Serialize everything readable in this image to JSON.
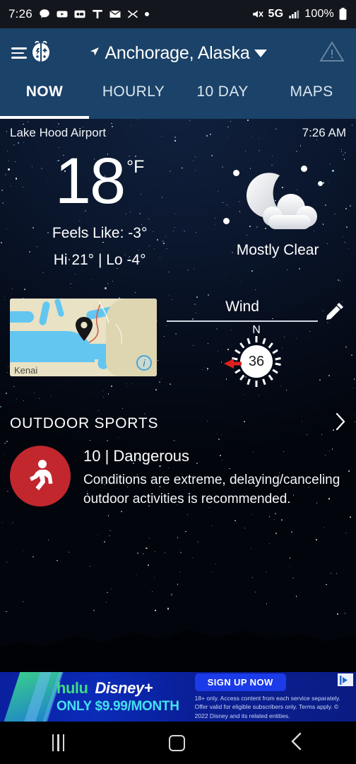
{
  "status_bar": {
    "time": "7:26",
    "network": "5G",
    "battery": "100%",
    "icons": [
      "chat-bubble-icon",
      "youtube-icon",
      "voicemail-icon",
      "t-mobile-icon",
      "mail-icon",
      "samsung-smartthings-icon",
      "dot-icon"
    ],
    "right_icons": [
      "mute-icon",
      "signal-bars-icon",
      "battery-icon"
    ]
  },
  "header": {
    "menu_icon": "hamburger-menu-icon",
    "logo": "weatherbug-ladybug-logo",
    "location": "Anchorage, Alaska",
    "location_pin_icon": "location-arrow-icon",
    "dropdown_icon": "chevron-down-icon",
    "alert_icon": "alert-triangle-icon"
  },
  "tabs": [
    {
      "label": "NOW",
      "active": true
    },
    {
      "label": "HOURLY",
      "active": false
    },
    {
      "label": "10 DAY",
      "active": false
    },
    {
      "label": "MAPS",
      "active": false
    }
  ],
  "station": {
    "name": "Lake Hood Airport",
    "time": "7:26 AM"
  },
  "current": {
    "temperature": "18",
    "unit": "°F",
    "feels_like": "Feels Like: -3°",
    "hi_lo": "Hi 21° | Lo -4°",
    "condition": "Mostly Clear",
    "condition_icon": "moon-with-cloud-icon"
  },
  "map_card": {
    "label": "Kenai",
    "pin_icon": "map-pin-icon",
    "info_icon": "info-icon"
  },
  "wind_card": {
    "title": "Wind",
    "edit_icon": "pencil-edit-icon",
    "compass_north": "N",
    "speed": "36",
    "direction_icon": "wind-direction-arrow-icon"
  },
  "outdoor_sports": {
    "title": "OUTDOOR SPORTS",
    "chevron_icon": "chevron-right-icon",
    "badge_icon": "running-person-icon",
    "badge_color": "#c1272d",
    "level": "10 | Dangerous",
    "description": "Conditions are extreme, delaying/canceling outdoor activities is recommended."
  },
  "ad": {
    "brand_1": "hulu",
    "brand_2": "Disney+",
    "price": "ONLY $9.99/MONTH",
    "cta": "SIGN UP NOW",
    "fine_print": "18+ only. Access content from each service separately. Offer valid for eligible subscribers only. Terms apply. © 2022 Disney and its related entities.",
    "adchoices_icon": "adchoices-icon"
  },
  "nav_bar": {
    "recents_icon": "recents-icon",
    "home_icon": "home-icon",
    "back_icon": "back-icon"
  }
}
